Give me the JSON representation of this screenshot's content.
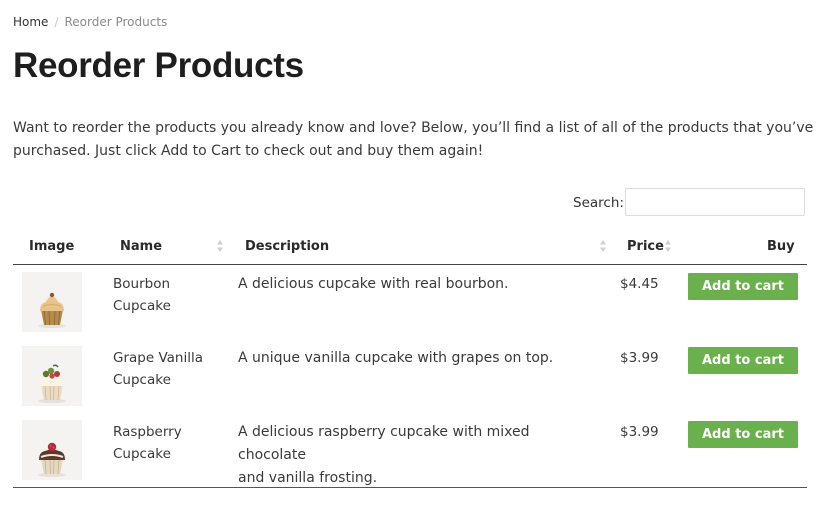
{
  "breadcrumb": {
    "home": "Home",
    "separator": "/",
    "current": "Reorder Products"
  },
  "page": {
    "title": "Reorder Products",
    "intro_line1": "Want to reorder the products you already know and love? Below, you’ll find a list of all of the products that you’ve",
    "intro_line2": "purchased. Just click Add to Cart to check out and buy them again!"
  },
  "search": {
    "label": "Search:",
    "value": ""
  },
  "table": {
    "columns": {
      "image": "Image",
      "name": "Name",
      "description": "Description",
      "price": "Price",
      "buy": "Buy"
    },
    "rows": [
      {
        "name_line1": "Bourbon",
        "name_line2": "Cupcake",
        "desc_line1": "A delicious cupcake with real bourbon.",
        "desc_line2": "",
        "price": "$4.45",
        "button": "Add to cart",
        "image": "cupcake-bourbon-thumbnail"
      },
      {
        "name_line1": "Grape Vanilla",
        "name_line2": "Cupcake",
        "desc_line1": "A unique vanilla cupcake with grapes on top.",
        "desc_line2": "",
        "price": "$3.99",
        "button": "Add to cart",
        "image": "cupcake-grape-vanilla-thumbnail"
      },
      {
        "name_line1": "Raspberry",
        "name_line2": "Cupcake",
        "desc_line1": "A delicious raspberry cupcake with mixed chocolate",
        "desc_line2": "and vanilla frosting.",
        "price": "$3.99",
        "button": "Add to cart",
        "image": "cupcake-raspberry-thumbnail"
      }
    ]
  },
  "colors": {
    "accent_button": "#6ab04c",
    "title_text": "#1e1e1e",
    "body_text": "#3a3a3a",
    "breadcrumb_current": "#8a8a8a"
  }
}
